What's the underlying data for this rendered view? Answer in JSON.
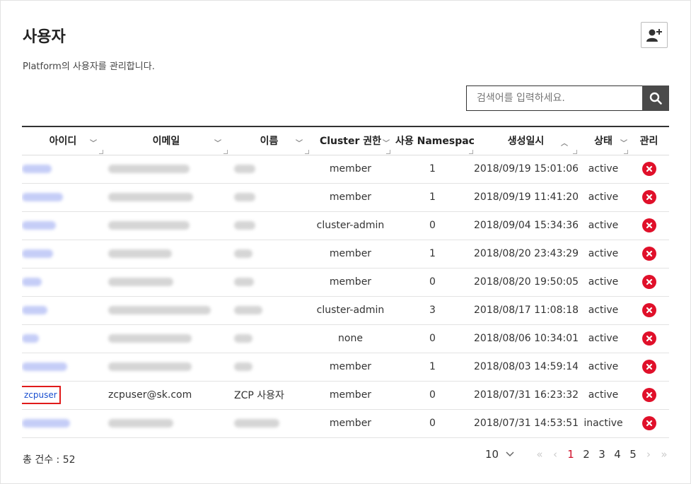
{
  "page": {
    "title": "사용자",
    "subtitle": "Platform의 사용자를 관리합니다."
  },
  "search": {
    "placeholder": "검색어를 입력하세요."
  },
  "colors": {
    "delete": "#e0102a",
    "active_page": "#d0102a",
    "id_link": "#1a4fd0",
    "highlight": "#e01b1b"
  },
  "table": {
    "columns": [
      "아이디",
      "이메일",
      "이름",
      "Cluster 권한",
      "사용 Namespace",
      "생성일시",
      "상태",
      "관리"
    ],
    "rows": [
      {
        "id": "",
        "email": "",
        "name": "",
        "role": "member",
        "ns": "1",
        "created": "2018/09/19 15:01:06",
        "status": "active"
      },
      {
        "id": "",
        "email": "",
        "name": "",
        "role": "member",
        "ns": "1",
        "created": "2018/09/19 11:41:20",
        "status": "active"
      },
      {
        "id": "",
        "email": "",
        "name": "",
        "role": "cluster-admin",
        "ns": "0",
        "created": "2018/09/04 15:34:36",
        "status": "active"
      },
      {
        "id": "",
        "email": "",
        "name": "",
        "role": "member",
        "ns": "1",
        "created": "2018/08/20 23:43:29",
        "status": "active"
      },
      {
        "id": "",
        "email": "",
        "name": "",
        "role": "member",
        "ns": "0",
        "created": "2018/08/20 19:50:05",
        "status": "active"
      },
      {
        "id": "",
        "email": "",
        "name": "",
        "role": "cluster-admin",
        "ns": "3",
        "created": "2018/08/17 11:08:18",
        "status": "active"
      },
      {
        "id": "",
        "email": "",
        "name": "",
        "role": "none",
        "ns": "0",
        "created": "2018/08/06 10:34:01",
        "status": "active"
      },
      {
        "id": "",
        "email": "",
        "name": "",
        "role": "member",
        "ns": "1",
        "created": "2018/08/03 14:59:14",
        "status": "active"
      },
      {
        "id": "zcpuser",
        "email": "zcpuser@sk.com",
        "name": "ZCP 사용자",
        "role": "member",
        "ns": "0",
        "created": "2018/07/31 16:23:32",
        "status": "active"
      },
      {
        "id": "",
        "email": "",
        "name": "",
        "role": "member",
        "ns": "0",
        "created": "2018/07/31 14:53:51",
        "status": "inactive"
      }
    ]
  },
  "footer": {
    "total": "총 건수 : 52",
    "page_size": "10",
    "pages": [
      "1",
      "2",
      "3",
      "4",
      "5"
    ],
    "current_page": "1"
  }
}
